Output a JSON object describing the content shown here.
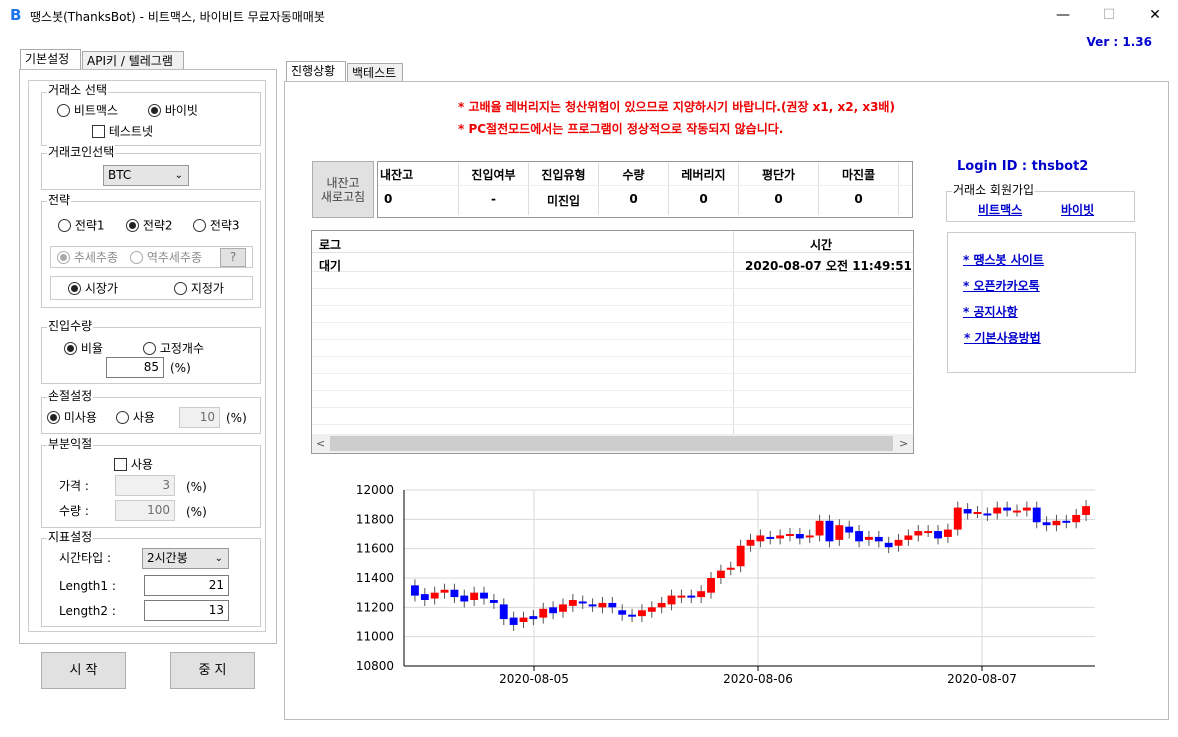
{
  "window": {
    "title": "땡스봇(ThanksBot) - 비트맥스, 바이비트 무료자동매매봇",
    "minimize": "—",
    "maximize": "☐",
    "close": "✕",
    "version": "Ver :  1.36"
  },
  "left_tabs": [
    "기본설정",
    "API키 / 텔레그램"
  ],
  "exchange_group": {
    "label": "거래소 선택",
    "bitmex": "비트맥스",
    "bybit": "바이빗",
    "testnet": "테스트넷",
    "selected": "bybit"
  },
  "coin_group": {
    "label": "거래코인선택",
    "value": "BTC"
  },
  "strategy_group": {
    "label": "전략",
    "options": [
      "전략1",
      "전략2",
      "전략3"
    ],
    "selected": "전략2",
    "trend": "추세추종",
    "counter_trend": "역추세추종",
    "help": "?",
    "market": "시장가",
    "limit": "지정가",
    "order_type": "시장가"
  },
  "entry_group": {
    "label": "진입수량",
    "ratio": "비율",
    "fixed": "고정개수",
    "value": "85",
    "unit": "(%)"
  },
  "stoploss_group": {
    "label": "손절설정",
    "off": "미사용",
    "on": "사용",
    "value": "10",
    "unit": "(%)"
  },
  "partial_group": {
    "label": "부분익절",
    "use": "사용",
    "price_label": "가격 :",
    "price_value": "3",
    "qty_label": "수량 :",
    "qty_value": "100",
    "unit": "(%)"
  },
  "indicator_group": {
    "label": "지표설정",
    "timeframe_label": "시간타입 :",
    "timeframe_value": "2시간봉",
    "length1_label": "Length1 :",
    "length1_value": "21",
    "length2_label": "Length2 :",
    "length2_value": "13"
  },
  "buttons": {
    "start": "시 작",
    "stop": "중 지"
  },
  "right_tabs": [
    "진행상황",
    "백테스트"
  ],
  "warnings": [
    "* 고배율 레버리지는 청산위험이 있으므로 지양하시기 바랍니다.(권장 x1, x2, x3배)",
    "* PC절전모드에서는 프로그램이 정상적으로 작동되지 않습니다."
  ],
  "refresh_button": {
    "line1": "내잔고",
    "line2": "새로고침"
  },
  "status_table": {
    "headers": [
      "내잔고",
      "진입여부",
      "진입유형",
      "수량",
      "레버리지",
      "평단가",
      "마진콜"
    ],
    "values": [
      "0",
      "-",
      "미진입",
      "0",
      "0",
      "0",
      "0"
    ]
  },
  "login": {
    "label": "Login ID : thsbot2",
    "signup_label": "거래소 회원가입",
    "bitmex": "비트맥스",
    "bybit": "바이빗"
  },
  "links": [
    "* 땡스봇 사이트",
    "* 오픈카카오톡",
    "* 공지사항",
    "* 기본사용방법"
  ],
  "log": {
    "header_log": "로그",
    "header_time": "시간",
    "rows": [
      {
        "log": "대기",
        "time": "2020-08-07 오전 11:49:51"
      }
    ]
  },
  "colors": {
    "up": "#ff0000",
    "down": "#0000ff",
    "link": "#0000cc",
    "warning": "#e00000"
  },
  "chart_data": {
    "type": "candlestick",
    "ylim": [
      10800,
      12000
    ],
    "yticks": [
      10800,
      11000,
      11200,
      11400,
      11600,
      11800,
      12000
    ],
    "xticks": [
      "2020-08-05",
      "2020-08-06",
      "2020-08-07"
    ],
    "candles": [
      [
        11350,
        11280
      ],
      [
        11290,
        11250
      ],
      [
        11260,
        11300
      ],
      [
        11300,
        11320
      ],
      [
        11320,
        11270
      ],
      [
        11280,
        11240
      ],
      [
        11250,
        11300
      ],
      [
        11300,
        11260
      ],
      [
        11250,
        11230
      ],
      [
        11220,
        11120
      ],
      [
        11130,
        11080
      ],
      [
        11100,
        11130
      ],
      [
        11140,
        11120
      ],
      [
        11130,
        11190
      ],
      [
        11200,
        11160
      ],
      [
        11170,
        11220
      ],
      [
        11210,
        11250
      ],
      [
        11240,
        11230
      ],
      [
        11220,
        11210
      ],
      [
        11200,
        11230
      ],
      [
        11230,
        11200
      ],
      [
        11180,
        11150
      ],
      [
        11150,
        11140
      ],
      [
        11140,
        11180
      ],
      [
        11170,
        11200
      ],
      [
        11200,
        11230
      ],
      [
        11220,
        11280
      ],
      [
        11270,
        11280
      ],
      [
        11280,
        11270
      ],
      [
        11270,
        11310
      ],
      [
        11300,
        11400
      ],
      [
        11400,
        11450
      ],
      [
        11460,
        11470
      ],
      [
        11480,
        11620
      ],
      [
        11620,
        11660
      ],
      [
        11650,
        11690
      ],
      [
        11680,
        11670
      ],
      [
        11670,
        11690
      ],
      [
        11690,
        11700
      ],
      [
        11700,
        11670
      ],
      [
        11680,
        11690
      ],
      [
        11690,
        11790
      ],
      [
        11790,
        11650
      ],
      [
        11660,
        11760
      ],
      [
        11750,
        11710
      ],
      [
        11720,
        11650
      ],
      [
        11660,
        11680
      ],
      [
        11680,
        11650
      ],
      [
        11640,
        11610
      ],
      [
        11620,
        11660
      ],
      [
        11660,
        11690
      ],
      [
        11690,
        11720
      ],
      [
        11720,
        11720
      ],
      [
        11720,
        11670
      ],
      [
        11680,
        11730
      ],
      [
        11730,
        11880
      ],
      [
        11870,
        11840
      ],
      [
        11850,
        11850
      ],
      [
        11840,
        11830
      ],
      [
        11840,
        11880
      ],
      [
        11880,
        11860
      ],
      [
        11860,
        11860
      ],
      [
        11860,
        11880
      ],
      [
        11880,
        11780
      ],
      [
        11780,
        11760
      ],
      [
        11760,
        11790
      ],
      [
        11790,
        11780
      ],
      [
        11780,
        11830
      ],
      [
        11830,
        11890
      ]
    ]
  }
}
